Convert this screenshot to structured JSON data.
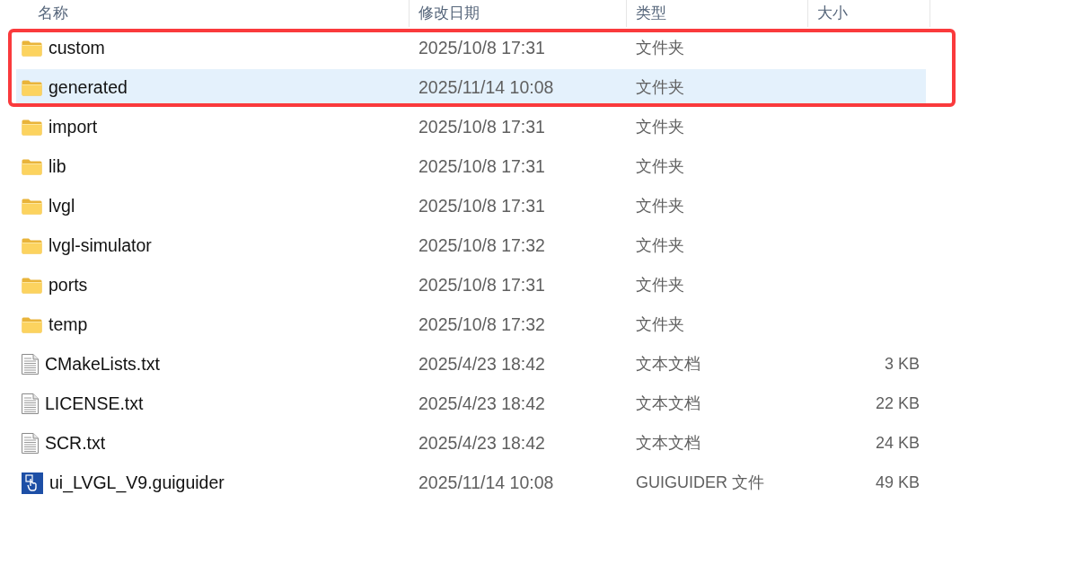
{
  "columns": [
    {
      "label": "名称"
    },
    {
      "label": "修改日期"
    },
    {
      "label": "类型"
    },
    {
      "label": "大小"
    }
  ],
  "rows": [
    {
      "kind": "folder",
      "name": "custom",
      "modified": "2025/10/8 17:31",
      "type": "文件夹",
      "selected": false,
      "annotated": true
    },
    {
      "kind": "folder",
      "name": "generated",
      "modified": "2025/11/14 10:08",
      "type": "文件夹",
      "selected": true,
      "annotated": true
    },
    {
      "kind": "folder",
      "name": "import",
      "modified": "2025/10/8 17:31",
      "type": "文件夹",
      "selected": false,
      "annotated": false
    },
    {
      "kind": "folder",
      "name": "lib",
      "modified": "2025/10/8 17:31",
      "type": "文件夹",
      "selected": false,
      "annotated": false
    },
    {
      "kind": "folder",
      "name": "lvgl",
      "modified": "2025/10/8 17:31",
      "type": "文件夹",
      "selected": false,
      "annotated": false
    },
    {
      "kind": "folder",
      "name": "lvgl-simulator",
      "modified": "2025/10/8 17:32",
      "type": "文件夹",
      "selected": false,
      "annotated": false
    },
    {
      "kind": "folder",
      "name": "ports",
      "modified": "2025/10/8 17:31",
      "type": "文件夹",
      "selected": false,
      "annotated": false
    },
    {
      "kind": "folder",
      "name": "temp",
      "modified": "2025/10/8 17:32",
      "type": "文件夹",
      "selected": false,
      "annotated": false
    },
    {
      "kind": "text",
      "name": "CMakeLists.txt",
      "modified": "2025/4/23 18:42",
      "type": "文本文档",
      "size": "3 KB",
      "selected": false,
      "annotated": false
    },
    {
      "kind": "text",
      "name": "LICENSE.txt",
      "modified": "2025/4/23 18:42",
      "type": "文本文档",
      "size": "22 KB",
      "selected": false,
      "annotated": false
    },
    {
      "kind": "text",
      "name": "SCR.txt",
      "modified": "2025/4/23 18:42",
      "type": "文本文档",
      "size": "24 KB",
      "selected": false,
      "annotated": false
    },
    {
      "kind": "app",
      "name": "ui_LVGL_V9.guiguider",
      "modified": "2025/11/14 10:08",
      "type": "GUIGUIDER 文件",
      "size": "49 KB",
      "selected": false,
      "annotated": false
    }
  ]
}
